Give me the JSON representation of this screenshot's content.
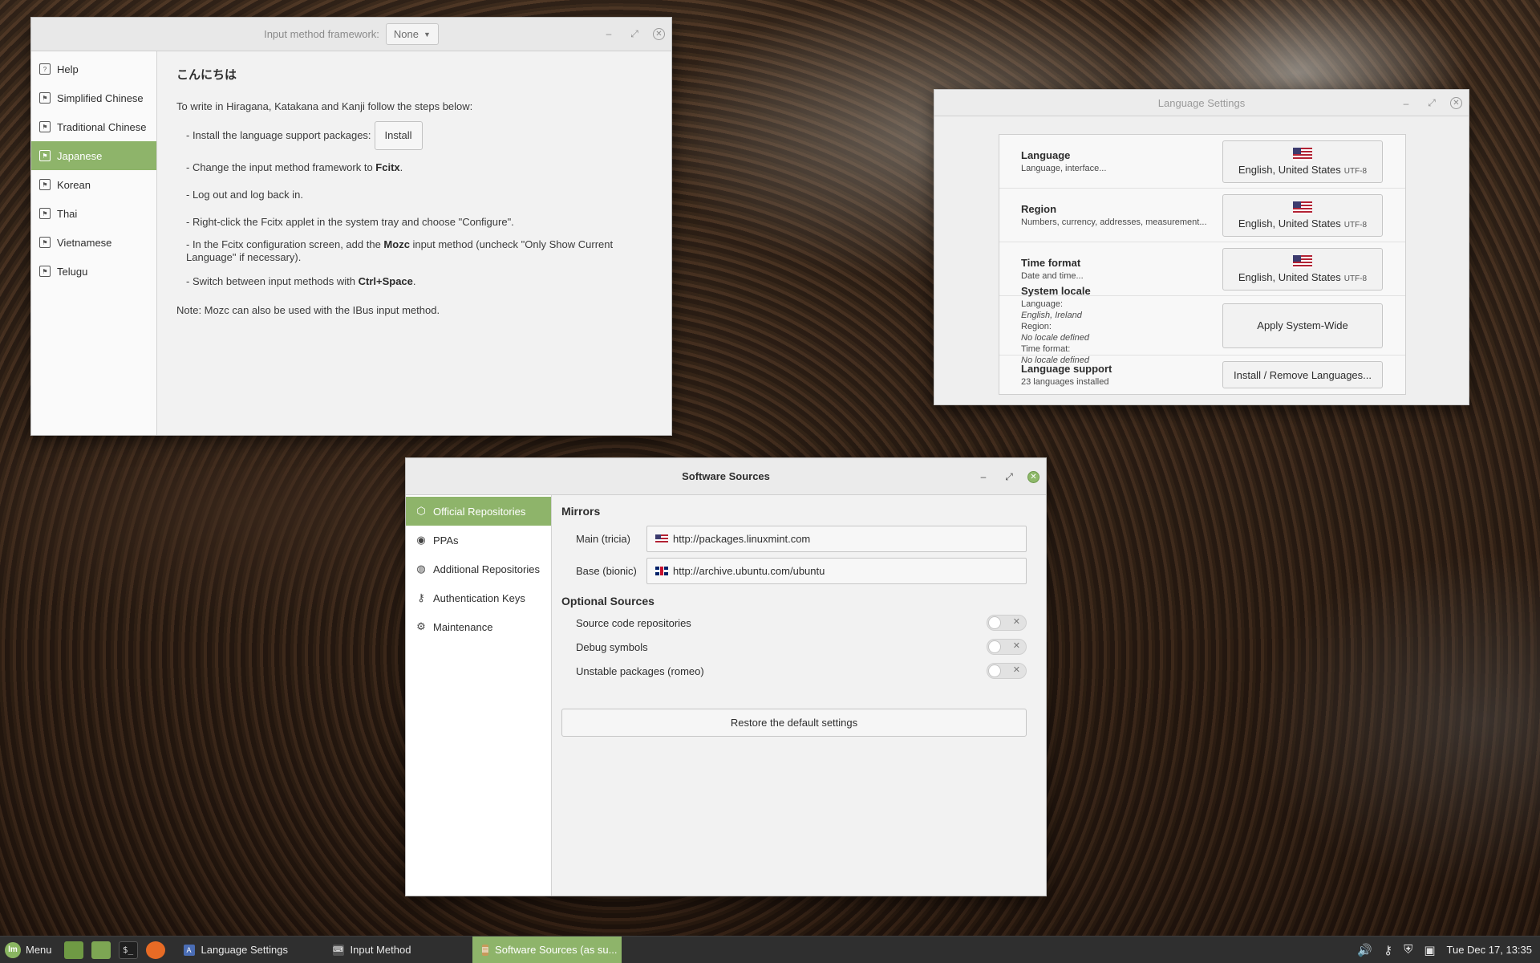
{
  "input_method": {
    "framework_label": "Input method framework:",
    "framework_value": "None",
    "sidebar": [
      {
        "label": "Help",
        "icon": "help-icon",
        "selected": false
      },
      {
        "label": "Simplified Chinese",
        "icon": "flag-icon",
        "selected": false
      },
      {
        "label": "Traditional Chinese",
        "icon": "flag-icon",
        "selected": false
      },
      {
        "label": "Japanese",
        "icon": "flag-icon",
        "selected": true
      },
      {
        "label": "Korean",
        "icon": "flag-icon",
        "selected": false
      },
      {
        "label": "Thai",
        "icon": "flag-icon",
        "selected": false
      },
      {
        "label": "Vietnamese",
        "icon": "flag-icon",
        "selected": false
      },
      {
        "label": "Telugu",
        "icon": "flag-icon",
        "selected": false
      }
    ],
    "heading": "こんにちは",
    "intro": "To write in Hiragana, Katakana and Kanji follow the steps below:",
    "step1": "- Install the language support packages:",
    "install_button": "Install",
    "step2_pre": "- Change the input method framework to ",
    "step2_bold": "Fcitx",
    "step2_post": ".",
    "step3": "- Log out and log back in.",
    "step4": "- Right-click the Fcitx applet in the system tray and choose \"Configure\".",
    "step5_pre": "- In the Fcitx configuration screen, add the ",
    "step5_bold": "Mozc",
    "step5_post": " input method (uncheck \"Only Show Current Language\" if necessary).",
    "step6_pre": "- Switch between input methods with ",
    "step6_bold": "Ctrl+Space",
    "step6_post": ".",
    "note": "Note: Mozc can also be used with the IBus input method."
  },
  "language_settings": {
    "title": "Language Settings",
    "rows": {
      "language": {
        "title": "Language",
        "desc": "Language, interface...",
        "value": "English, United States",
        "encoding": "UTF-8"
      },
      "region": {
        "title": "Region",
        "desc": "Numbers, currency, addresses, measurement...",
        "value": "English, United States",
        "encoding": "UTF-8"
      },
      "time_format": {
        "title": "Time format",
        "desc": "Date and time...",
        "value": "English, United States",
        "encoding": "UTF-8"
      },
      "system_locale": {
        "title": "System locale",
        "language_label": "Language:",
        "language_value": "English, Ireland",
        "region_label": "Region:",
        "region_value": "No locale defined",
        "time_label": "Time format:",
        "time_value": "No locale defined",
        "button": "Apply System-Wide"
      },
      "language_support": {
        "title": "Language support",
        "desc": "23 languages installed",
        "button": "Install / Remove Languages..."
      }
    }
  },
  "software_sources": {
    "title": "Software Sources",
    "sidebar": [
      {
        "label": "Official Repositories",
        "icon": "box-icon",
        "selected": true
      },
      {
        "label": "PPAs",
        "icon": "ppa-icon",
        "selected": false
      },
      {
        "label": "Additional Repositories",
        "icon": "globe-icon",
        "selected": false
      },
      {
        "label": "Authentication Keys",
        "icon": "key-icon",
        "selected": false
      },
      {
        "label": "Maintenance",
        "icon": "maintenance-icon",
        "selected": false
      }
    ],
    "mirrors_heading": "Mirrors",
    "main_label": "Main (tricia)",
    "main_url": "http://packages.linuxmint.com",
    "base_label": "Base (bionic)",
    "base_url": "http://archive.ubuntu.com/ubuntu",
    "optional_heading": "Optional Sources",
    "optional": [
      {
        "label": "Source code repositories",
        "enabled": false
      },
      {
        "label": "Debug symbols",
        "enabled": false
      },
      {
        "label": "Unstable packages (romeo)",
        "enabled": false
      }
    ],
    "restore_button": "Restore the default settings"
  },
  "taskbar": {
    "menu_label": "Menu",
    "tasks": [
      {
        "label": "Language Settings",
        "active": false
      },
      {
        "label": "Input Method",
        "active": false
      },
      {
        "label": "Software Sources (as su...",
        "active": true
      }
    ],
    "clock": "Tue Dec 17, 13:35"
  },
  "colors": {
    "accent": "#8eb46a",
    "taskbar": "#2f2f2f"
  }
}
